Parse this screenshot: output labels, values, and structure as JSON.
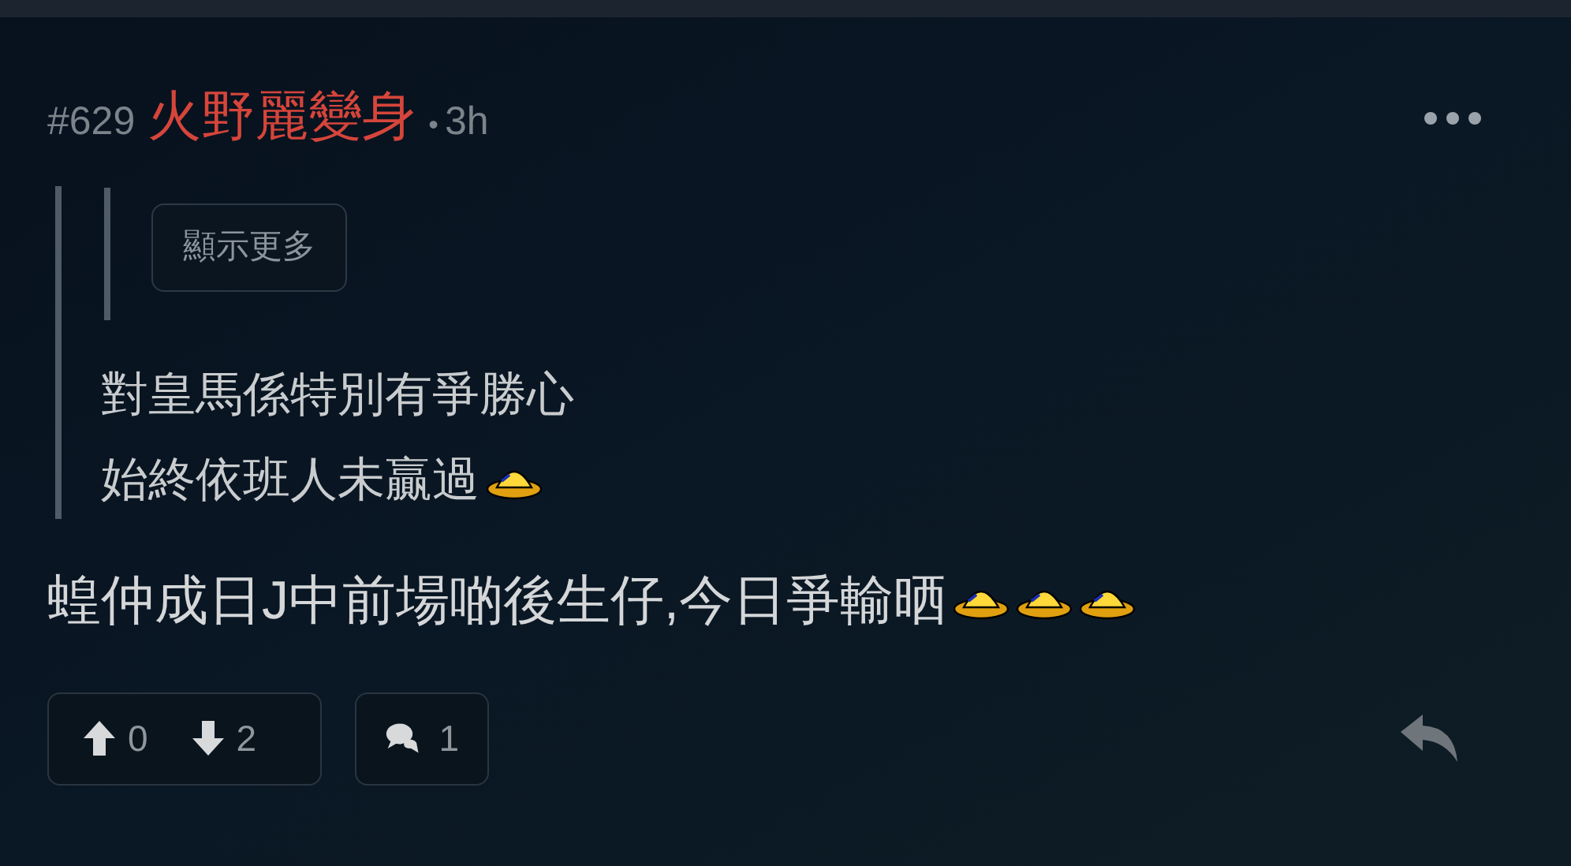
{
  "post": {
    "number": "#629",
    "author": "火野麗變身",
    "separator": "•",
    "time": "3h"
  },
  "quote": {
    "show_more": "顯示更多",
    "lines": [
      [
        {
          "kind": "text",
          "text": "對皇馬係特別有爭勝心"
        }
      ],
      [
        {
          "kind": "text",
          "text": "始終依班人未贏過"
        },
        {
          "kind": "emoticon"
        }
      ]
    ]
  },
  "body": [
    {
      "kind": "text",
      "text": "蝗仲成日J中前場啲後生仔,今日爭輸晒"
    },
    {
      "kind": "emoticon"
    },
    {
      "kind": "emoticon"
    },
    {
      "kind": "emoticon"
    }
  ],
  "actions": {
    "upvotes": "0",
    "downvotes": "2",
    "replies": "1"
  }
}
